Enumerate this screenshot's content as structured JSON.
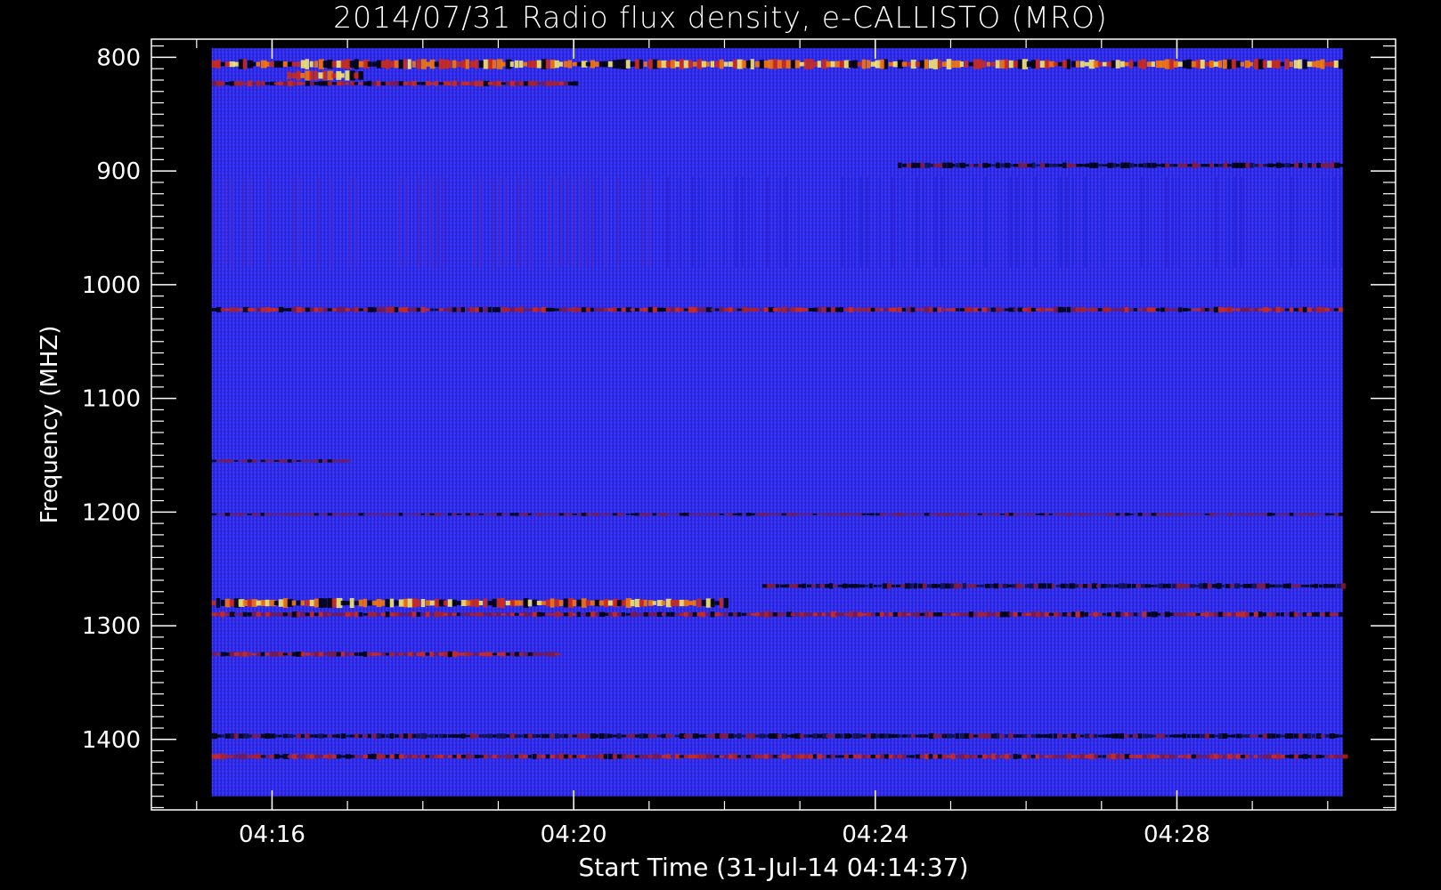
{
  "chart_data": {
    "type": "heatmap",
    "title": "2014/07/31  Radio flux density, e-CALLISTO (MRO)",
    "xlabel": "Start Time (31-Jul-14 04:14:37)",
    "ylabel": "Frequency (MHZ)",
    "x_ticks": [
      "04:16",
      "04:20",
      "04:24",
      "04:28"
    ],
    "x_tick_values_min": [
      256,
      260,
      264,
      268
    ],
    "y_ticks": [
      800,
      900,
      1000,
      1100,
      1200,
      1300,
      1400
    ],
    "xlim_min": [
      254.4,
      270.9
    ],
    "ylim_mhz": [
      1462,
      784
    ],
    "data_extent_min": [
      255.2,
      270.2
    ],
    "data_extent_mhz": [
      1450,
      792
    ],
    "colormap": [
      "#000000",
      "#2d1fd9",
      "#3a3af0",
      "#9a1a3a",
      "#d62a10",
      "#ff7a00",
      "#fff06a"
    ],
    "background_color": "#2f2ff0",
    "bands": [
      {
        "freq_mhz": 806,
        "t_start": 255.2,
        "t_end": 270.2,
        "level": "high"
      },
      {
        "freq_mhz": 816,
        "t_start": 256.2,
        "t_end": 257.2,
        "level": "high"
      },
      {
        "freq_mhz": 823,
        "t_start": 255.2,
        "t_end": 260.0,
        "level": "medium"
      },
      {
        "freq_mhz": 895,
        "t_start": 264.3,
        "t_end": 270.2,
        "level": "low"
      },
      {
        "freq_mhz": 1022,
        "t_start": 255.2,
        "t_end": 270.2,
        "level": "medium"
      },
      {
        "freq_mhz": 1155,
        "t_start": 255.2,
        "t_end": 257.0,
        "level": "weak"
      },
      {
        "freq_mhz": 1202,
        "t_start": 255.2,
        "t_end": 270.2,
        "level": "weak"
      },
      {
        "freq_mhz": 1265,
        "t_start": 262.5,
        "t_end": 270.2,
        "level": "low"
      },
      {
        "freq_mhz": 1280,
        "t_start": 255.2,
        "t_end": 262.0,
        "level": "high"
      },
      {
        "freq_mhz": 1290,
        "t_start": 255.2,
        "t_end": 270.2,
        "level": "medium"
      },
      {
        "freq_mhz": 1325,
        "t_start": 255.2,
        "t_end": 259.8,
        "level": "medium"
      },
      {
        "freq_mhz": 1397,
        "t_start": 255.2,
        "t_end": 270.2,
        "level": "low"
      },
      {
        "freq_mhz": 1415,
        "t_start": 255.2,
        "t_end": 270.2,
        "level": "medium"
      }
    ]
  }
}
